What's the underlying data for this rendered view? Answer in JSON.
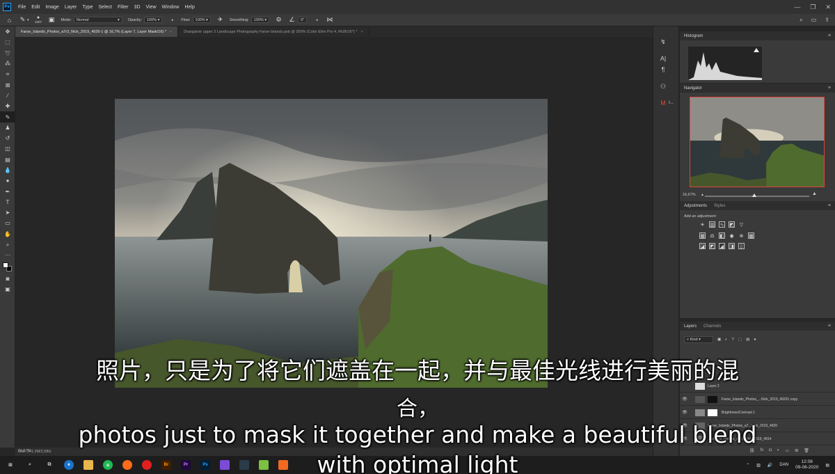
{
  "menubar": {
    "logo": "Ps",
    "items": [
      "File",
      "Edit",
      "Image",
      "Layer",
      "Type",
      "Select",
      "Filter",
      "3D",
      "View",
      "Window",
      "Help"
    ]
  },
  "options": {
    "brush_size": "1507",
    "mode_label": "Mode:",
    "mode_value": "Normal",
    "opacity_label": "Opacity:",
    "opacity_value": "100%",
    "flow_label": "Flow:",
    "flow_value": "100%",
    "smoothing_label": "Smoothing:",
    "smoothing_value": "100%",
    "angle_value": "0°"
  },
  "tabs": [
    {
      "label": "Faroe_Islands_Photos_a7r3_Nick_2019_4926-1 @ 16,7% (Layer 7, Layer Mask/16) *",
      "close": "×"
    },
    {
      "label": "Drangarnir upper 2 Landscape Photography Faroe Islands.psb @ 200% (Color Efex Pro 4, RGB/16*) *",
      "close": "×"
    }
  ],
  "status": {
    "zoom": "16,67%",
    "doc": "Dok: 241,3M/2,58G"
  },
  "iconstrip": {
    "label_a": "A|",
    "label_b": "¶",
    "label_c": "I..."
  },
  "panels": {
    "histogram": {
      "title": "Histogram"
    },
    "navigator": {
      "title": "Navigator",
      "zoom": "16,67%"
    },
    "adjustments": {
      "title": "Adjustments",
      "tab2": "Styles",
      "hint": "Add an adjustment"
    },
    "layers": {
      "title": "Layers",
      "tab2": "Channels",
      "filter": "Kind",
      "rows": [
        {
          "name": "Layer 2"
        },
        {
          "name": "Faroe_Islands_Photos_...Nick_2019_49201 copy"
        },
        {
          "name": "Brightness/Contrast 1"
        },
        {
          "name": "Faroe_Islands_Photos_a7...Nick_2019_4920"
        },
        {
          "name": "...Islands_Photos_a7r3_Nick_2019_4914"
        }
      ]
    }
  },
  "taskbar": {
    "lang": "DAN",
    "time": "12:08",
    "date": "09-06-2020",
    "apps": [
      {
        "name": "br",
        "label": "Br",
        "color": "#3d1f00",
        "fg": "#ff9a00"
      },
      {
        "name": "pr",
        "label": "Pr",
        "color": "#1e0a3c",
        "fg": "#e77cff"
      },
      {
        "name": "ps",
        "label": "Ps",
        "color": "#001e36",
        "fg": "#31a8ff"
      }
    ]
  },
  "subtitles": {
    "cn_line1": "照片，只是为了将它们遮盖在一起，并与最佳光线进行美丽的混",
    "cn_line2": "合，",
    "en_line1": "photos just to mask it together and make a beautiful blend",
    "en_line2": "with optimal light"
  }
}
